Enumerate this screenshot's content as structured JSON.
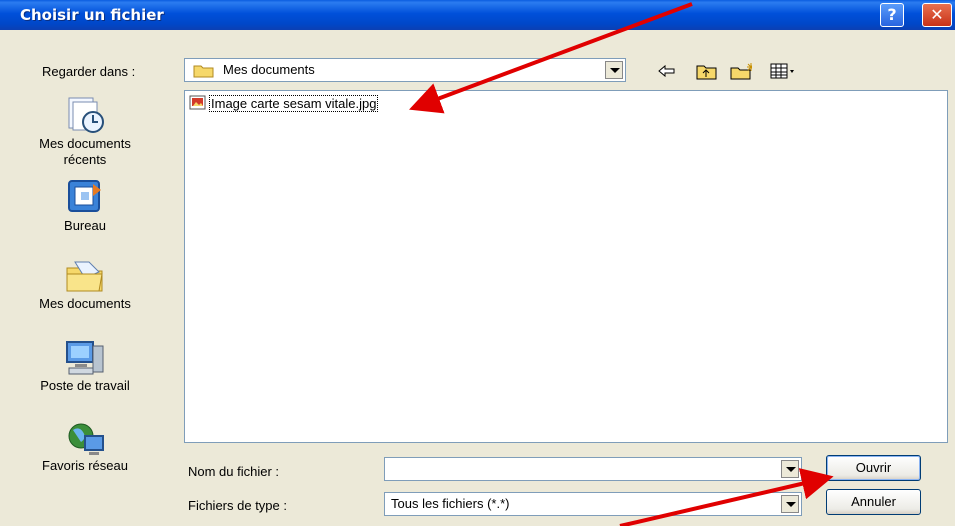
{
  "window": {
    "title": "Choisir un fichier",
    "help_glyph": "?",
    "close_glyph": "✕"
  },
  "look_in": {
    "label": "Regarder dans :",
    "value": "Mes documents"
  },
  "places": [
    {
      "label_line1": "Mes documents",
      "label_line2": "récents",
      "icon": "recent-documents-icon"
    },
    {
      "label_line1": "Bureau",
      "label_line2": "",
      "icon": "desktop-icon"
    },
    {
      "label_line1": "Mes documents",
      "label_line2": "",
      "icon": "my-documents-icon"
    },
    {
      "label_line1": "Poste de travail",
      "label_line2": "",
      "icon": "my-computer-icon"
    },
    {
      "label_line1": "Favoris réseau",
      "label_line2": "",
      "icon": "network-places-icon"
    }
  ],
  "files": [
    {
      "name": "Image carte sesam vitale.jpg",
      "icon": "image-file-icon"
    }
  ],
  "filename": {
    "label": "Nom du fichier :",
    "value": ""
  },
  "filetype": {
    "label": "Fichiers de type :",
    "value": "Tous les fichiers (*.*)"
  },
  "buttons": {
    "open": "Ouvrir",
    "cancel": "Annuler"
  },
  "colors": {
    "titlebar": "#0050DA",
    "annotation_arrow": "#E00000"
  }
}
